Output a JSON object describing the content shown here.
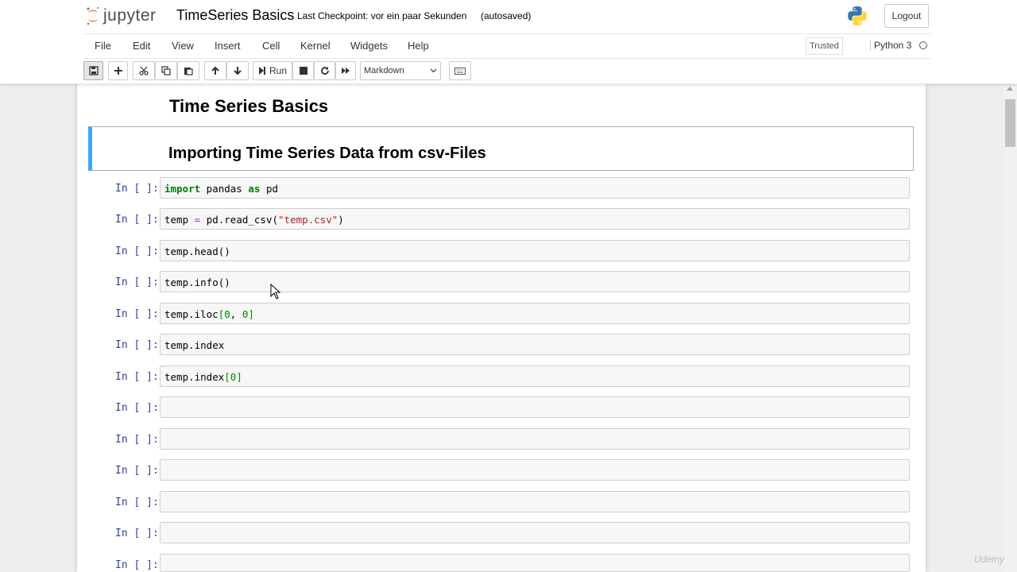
{
  "header": {
    "logo_text": "jupyter",
    "notebook_title": "TimeSeries Basics",
    "checkpoint": "Last Checkpoint: vor ein paar Sekunden",
    "autosave": "(autosaved)",
    "logout_label": "Logout"
  },
  "menubar": {
    "items": [
      "File",
      "Edit",
      "View",
      "Insert",
      "Cell",
      "Kernel",
      "Widgets",
      "Help"
    ],
    "trusted_label": "Trusted",
    "kernel_label": "Python 3"
  },
  "toolbar": {
    "run_label": "Run",
    "cell_type": "Markdown"
  },
  "notebook": {
    "heading1": "Time Series Basics",
    "heading2": "Importing Time Series Data from csv-Files",
    "prompt_label": "In [ ]:",
    "cells": [
      "import pandas as pd",
      "temp = pd.read_csv(\"temp.csv\")",
      "temp.head()",
      "temp.info()",
      "temp.iloc[0, 0]",
      "temp.index",
      "temp.index[0]",
      "",
      "",
      "",
      "",
      "",
      ""
    ]
  },
  "watermark": "Udemy",
  "colors": {
    "prompt": "#303f9f",
    "selected_cell_border": "#42a5f5",
    "keyword": "#008000",
    "string": "#ba2121"
  }
}
